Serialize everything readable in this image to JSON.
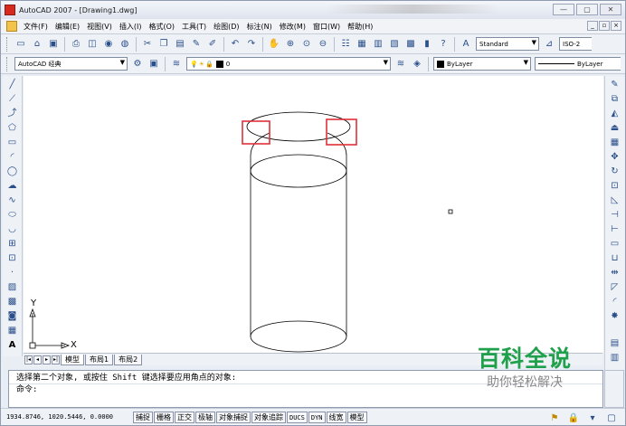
{
  "window": {
    "title": "AutoCAD 2007 - [Drawing1.dwg]",
    "controls": [
      "—",
      "▢",
      "✕"
    ],
    "doc_controls": [
      "_",
      "▫",
      "×"
    ]
  },
  "menu": {
    "items": [
      "文件(F)",
      "编辑(E)",
      "视图(V)",
      "插入(I)",
      "格式(O)",
      "工具(T)",
      "绘图(D)",
      "标注(N)",
      "修改(M)",
      "窗口(W)",
      "帮助(H)"
    ]
  },
  "toolbar1": {
    "text_style": "Standard",
    "dim_style": "ISO-2"
  },
  "toolbar2": {
    "workspace": "AutoCAD 经典",
    "layer": "0",
    "color": "ByLayer",
    "linetype": "ByLayer"
  },
  "ucs": {
    "y_label": "Y",
    "x_label": "X"
  },
  "layout_tabs": [
    "模型",
    "布局1",
    "布局2"
  ],
  "command": {
    "line1": "选择第二个对象, 或按住 Shift 键选择要应用角点的对象:",
    "line2": "命令:"
  },
  "status": {
    "coords": "1934.8746, 1020.5446, 0.0000",
    "buttons": [
      "捕捉",
      "栅格",
      "正交",
      "极轴",
      "对象捕捉",
      "对象追踪",
      "DUCS",
      "DYN",
      "线宽",
      "模型"
    ]
  },
  "watermark": {
    "title": "百科全说",
    "subtitle": "助你轻松解决"
  },
  "colors": {
    "highlight": "#e0303a",
    "watermark": "#1fa04a",
    "canvas": "#ffffff"
  }
}
